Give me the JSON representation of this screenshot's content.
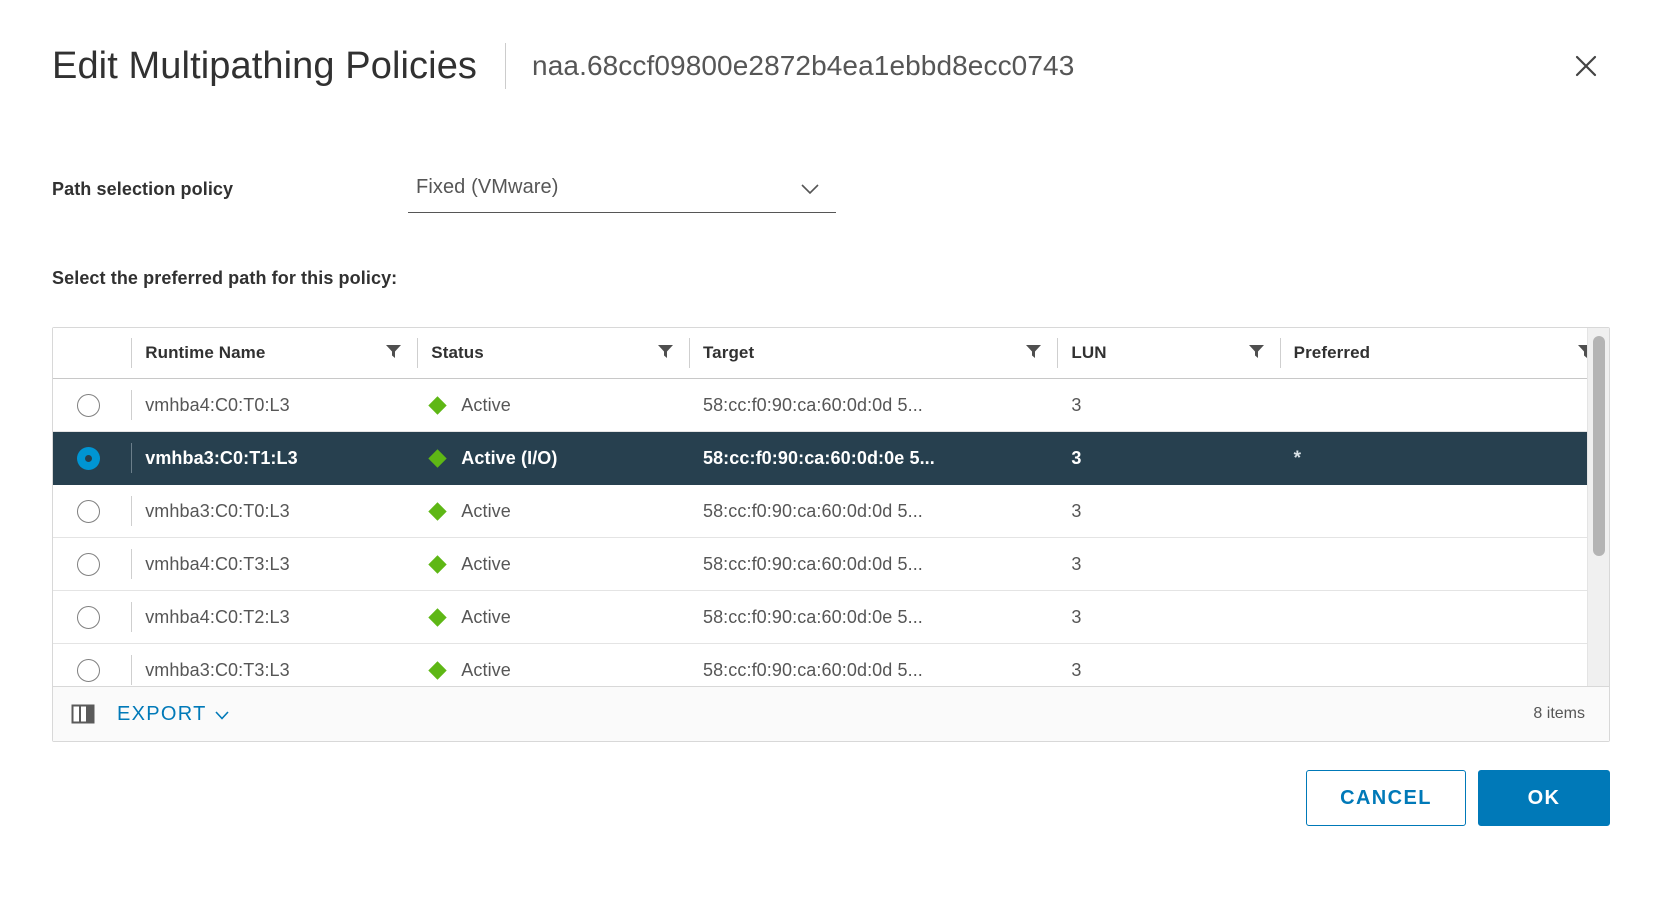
{
  "dialog": {
    "title": "Edit Multipathing Policies",
    "subtitle": "naa.68ccf09800e2872b4ea1ebbd8ecc0743",
    "close_icon": "close-icon"
  },
  "policy": {
    "label": "Path selection policy",
    "selected": "Fixed (VMware)",
    "caret_icon": "chevron-down-icon"
  },
  "section": {
    "label": "Select the preferred path for this policy:"
  },
  "table": {
    "columns": [
      {
        "key": "radio",
        "label": ""
      },
      {
        "key": "name",
        "label": "Runtime Name"
      },
      {
        "key": "status",
        "label": "Status"
      },
      {
        "key": "target",
        "label": "Target"
      },
      {
        "key": "lun",
        "label": "LUN"
      },
      {
        "key": "preferred",
        "label": "Preferred"
      }
    ],
    "filter_icon": "filter-icon",
    "rows": [
      {
        "selected": false,
        "name": "vmhba4:C0:T0:L3",
        "status": "Active",
        "target": "58:cc:f0:90:ca:60:0d:0d 5...",
        "lun": "3",
        "preferred": ""
      },
      {
        "selected": true,
        "name": "vmhba3:C0:T1:L3",
        "status": "Active (I/O)",
        "target": "58:cc:f0:90:ca:60:0d:0e 5...",
        "lun": "3",
        "preferred": "*"
      },
      {
        "selected": false,
        "name": "vmhba3:C0:T0:L3",
        "status": "Active",
        "target": "58:cc:f0:90:ca:60:0d:0d 5...",
        "lun": "3",
        "preferred": ""
      },
      {
        "selected": false,
        "name": "vmhba4:C0:T3:L3",
        "status": "Active",
        "target": "58:cc:f0:90:ca:60:0d:0d 5...",
        "lun": "3",
        "preferred": ""
      },
      {
        "selected": false,
        "name": "vmhba4:C0:T2:L3",
        "status": "Active",
        "target": "58:cc:f0:90:ca:60:0d:0e 5...",
        "lun": "3",
        "preferred": ""
      },
      {
        "selected": false,
        "name": "vmhba3:C0:T3:L3",
        "status": "Active",
        "target": "58:cc:f0:90:ca:60:0d:0d 5...",
        "lun": "3",
        "preferred": ""
      }
    ],
    "footer": {
      "column_toggle_icon": "columns-icon",
      "export_label": "EXPORT",
      "export_caret_icon": "chevron-down-icon",
      "items_count": "8 items"
    }
  },
  "actions": {
    "cancel_label": "CANCEL",
    "ok_label": "OK"
  },
  "colors": {
    "accent": "#0079b8",
    "selected_row": "#27404f",
    "status_active": "#5eb715",
    "radio_checked": "#0095d3"
  }
}
